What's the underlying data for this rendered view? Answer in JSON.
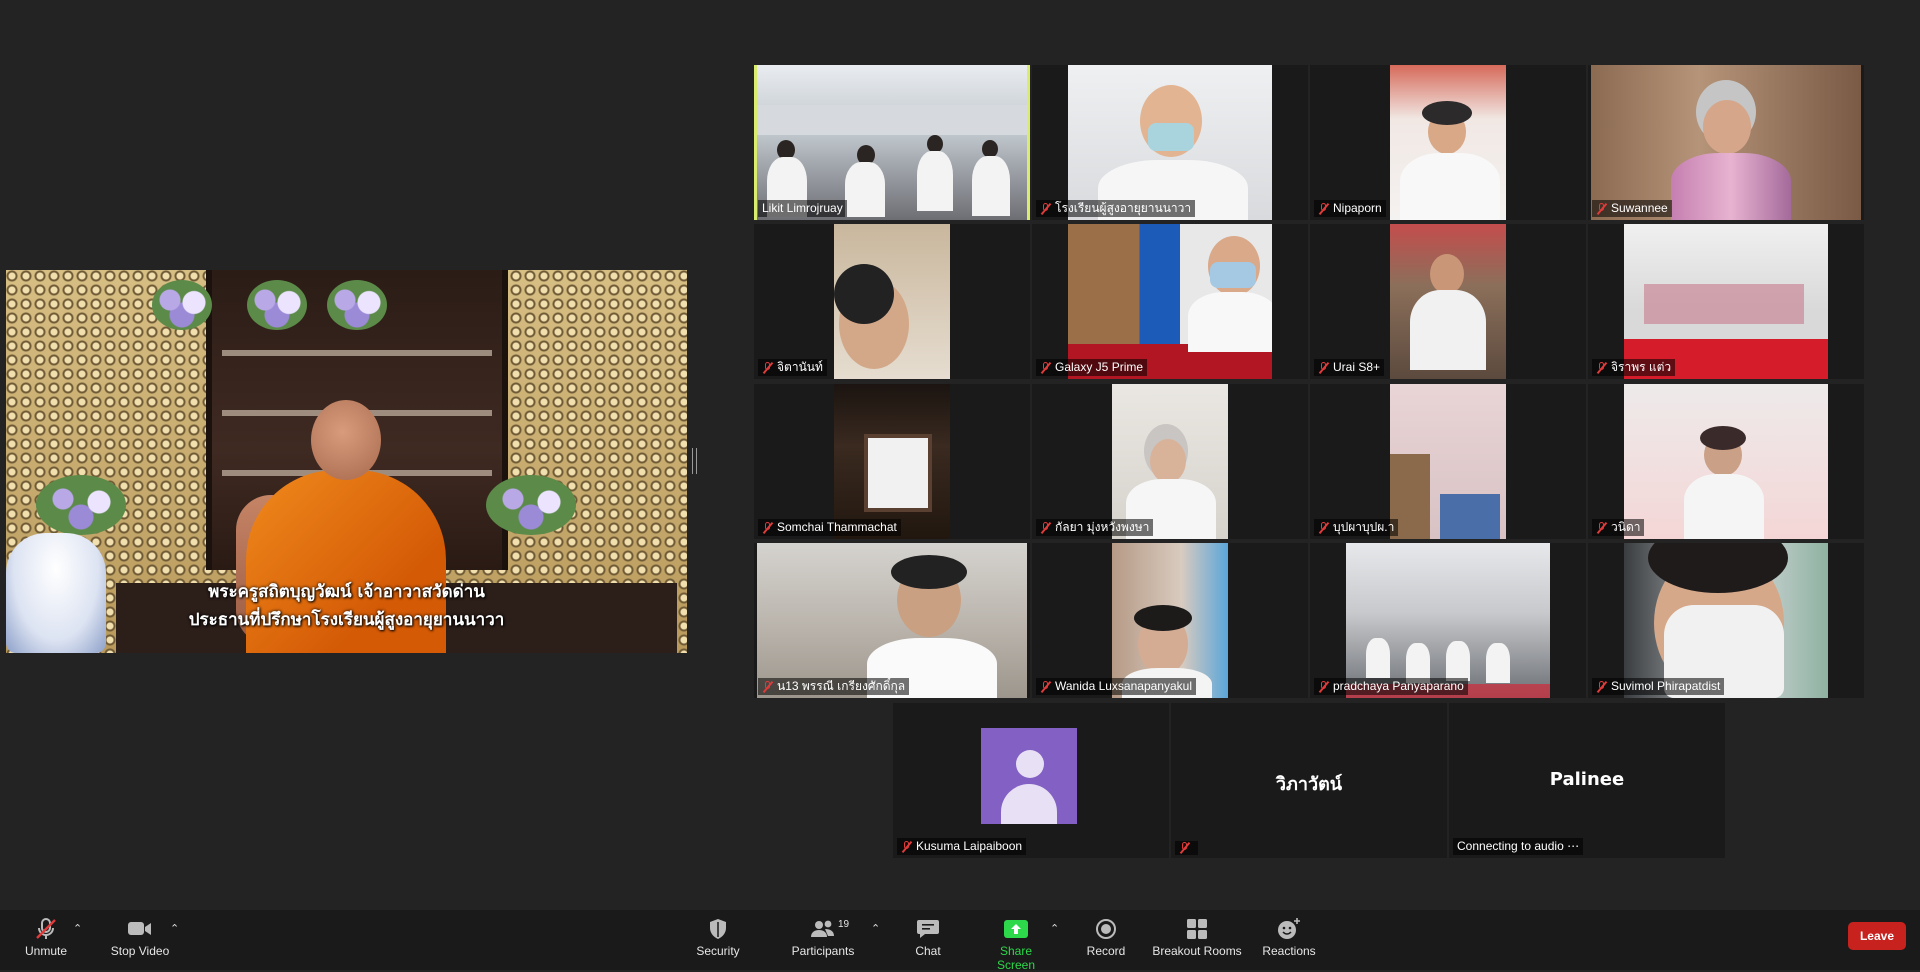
{
  "shared_view": {
    "caption_line1": "พระครูสถิตบุญวัฒน์ เจ้าอาวาสวัดด่าน",
    "caption_line2": "ประธานที่ปรึกษาโรงเรียนผู้สูงอายุยานนาวา"
  },
  "participants": [
    {
      "name": "Likit Limrojruay",
      "muted": false,
      "active": true
    },
    {
      "name": "โรงเรียนผู้สูงอายุยานนาวา",
      "muted": true
    },
    {
      "name": "Nipaporn",
      "muted": true
    },
    {
      "name": "Suwannee",
      "muted": true
    },
    {
      "name": "จิตานันท์",
      "muted": true
    },
    {
      "name": "Galaxy J5 Prime",
      "muted": true
    },
    {
      "name": "Urai S8+",
      "muted": true
    },
    {
      "name": "จิราพร แต่ว",
      "muted": true
    },
    {
      "name": "Somchai Thammachat",
      "muted": true
    },
    {
      "name": "กัลยา มุ่งหวังพงษา",
      "muted": true
    },
    {
      "name": "บุปผาบุปผ.า",
      "muted": true
    },
    {
      "name": "วนิดา",
      "muted": true
    },
    {
      "name": "น13 พรรณี เกรียงศักดิ์กุล",
      "muted": true
    },
    {
      "name": "Wanida Luxsanapanyakul",
      "muted": true
    },
    {
      "name": "pradchaya Panyaparano",
      "muted": true
    },
    {
      "name": "Suvimol Phirapatdist",
      "muted": true
    },
    {
      "name": "Kusuma Laipaiboon",
      "muted": true
    },
    {
      "name": "",
      "display_text": "วิภาวัตน์",
      "muted": true
    },
    {
      "name": "Connecting to audio ⋯",
      "display_text": "Palinee",
      "muted": false
    }
  ],
  "toolbar": {
    "unmute": "Unmute",
    "stop_video": "Stop Video",
    "security": "Security",
    "participants": "Participants",
    "participants_count": "19",
    "chat": "Chat",
    "share_screen": "Share Screen",
    "record": "Record",
    "breakout_rooms": "Breakout Rooms",
    "reactions": "Reactions",
    "leave": "Leave"
  },
  "colors": {
    "background": "#232323",
    "active_speaker_border": "#d9ec6e",
    "share_green": "#2dd84a",
    "leave_red": "#c7221e",
    "muted_red": "#e03b3b",
    "avatar_purple": "#8360c3"
  }
}
